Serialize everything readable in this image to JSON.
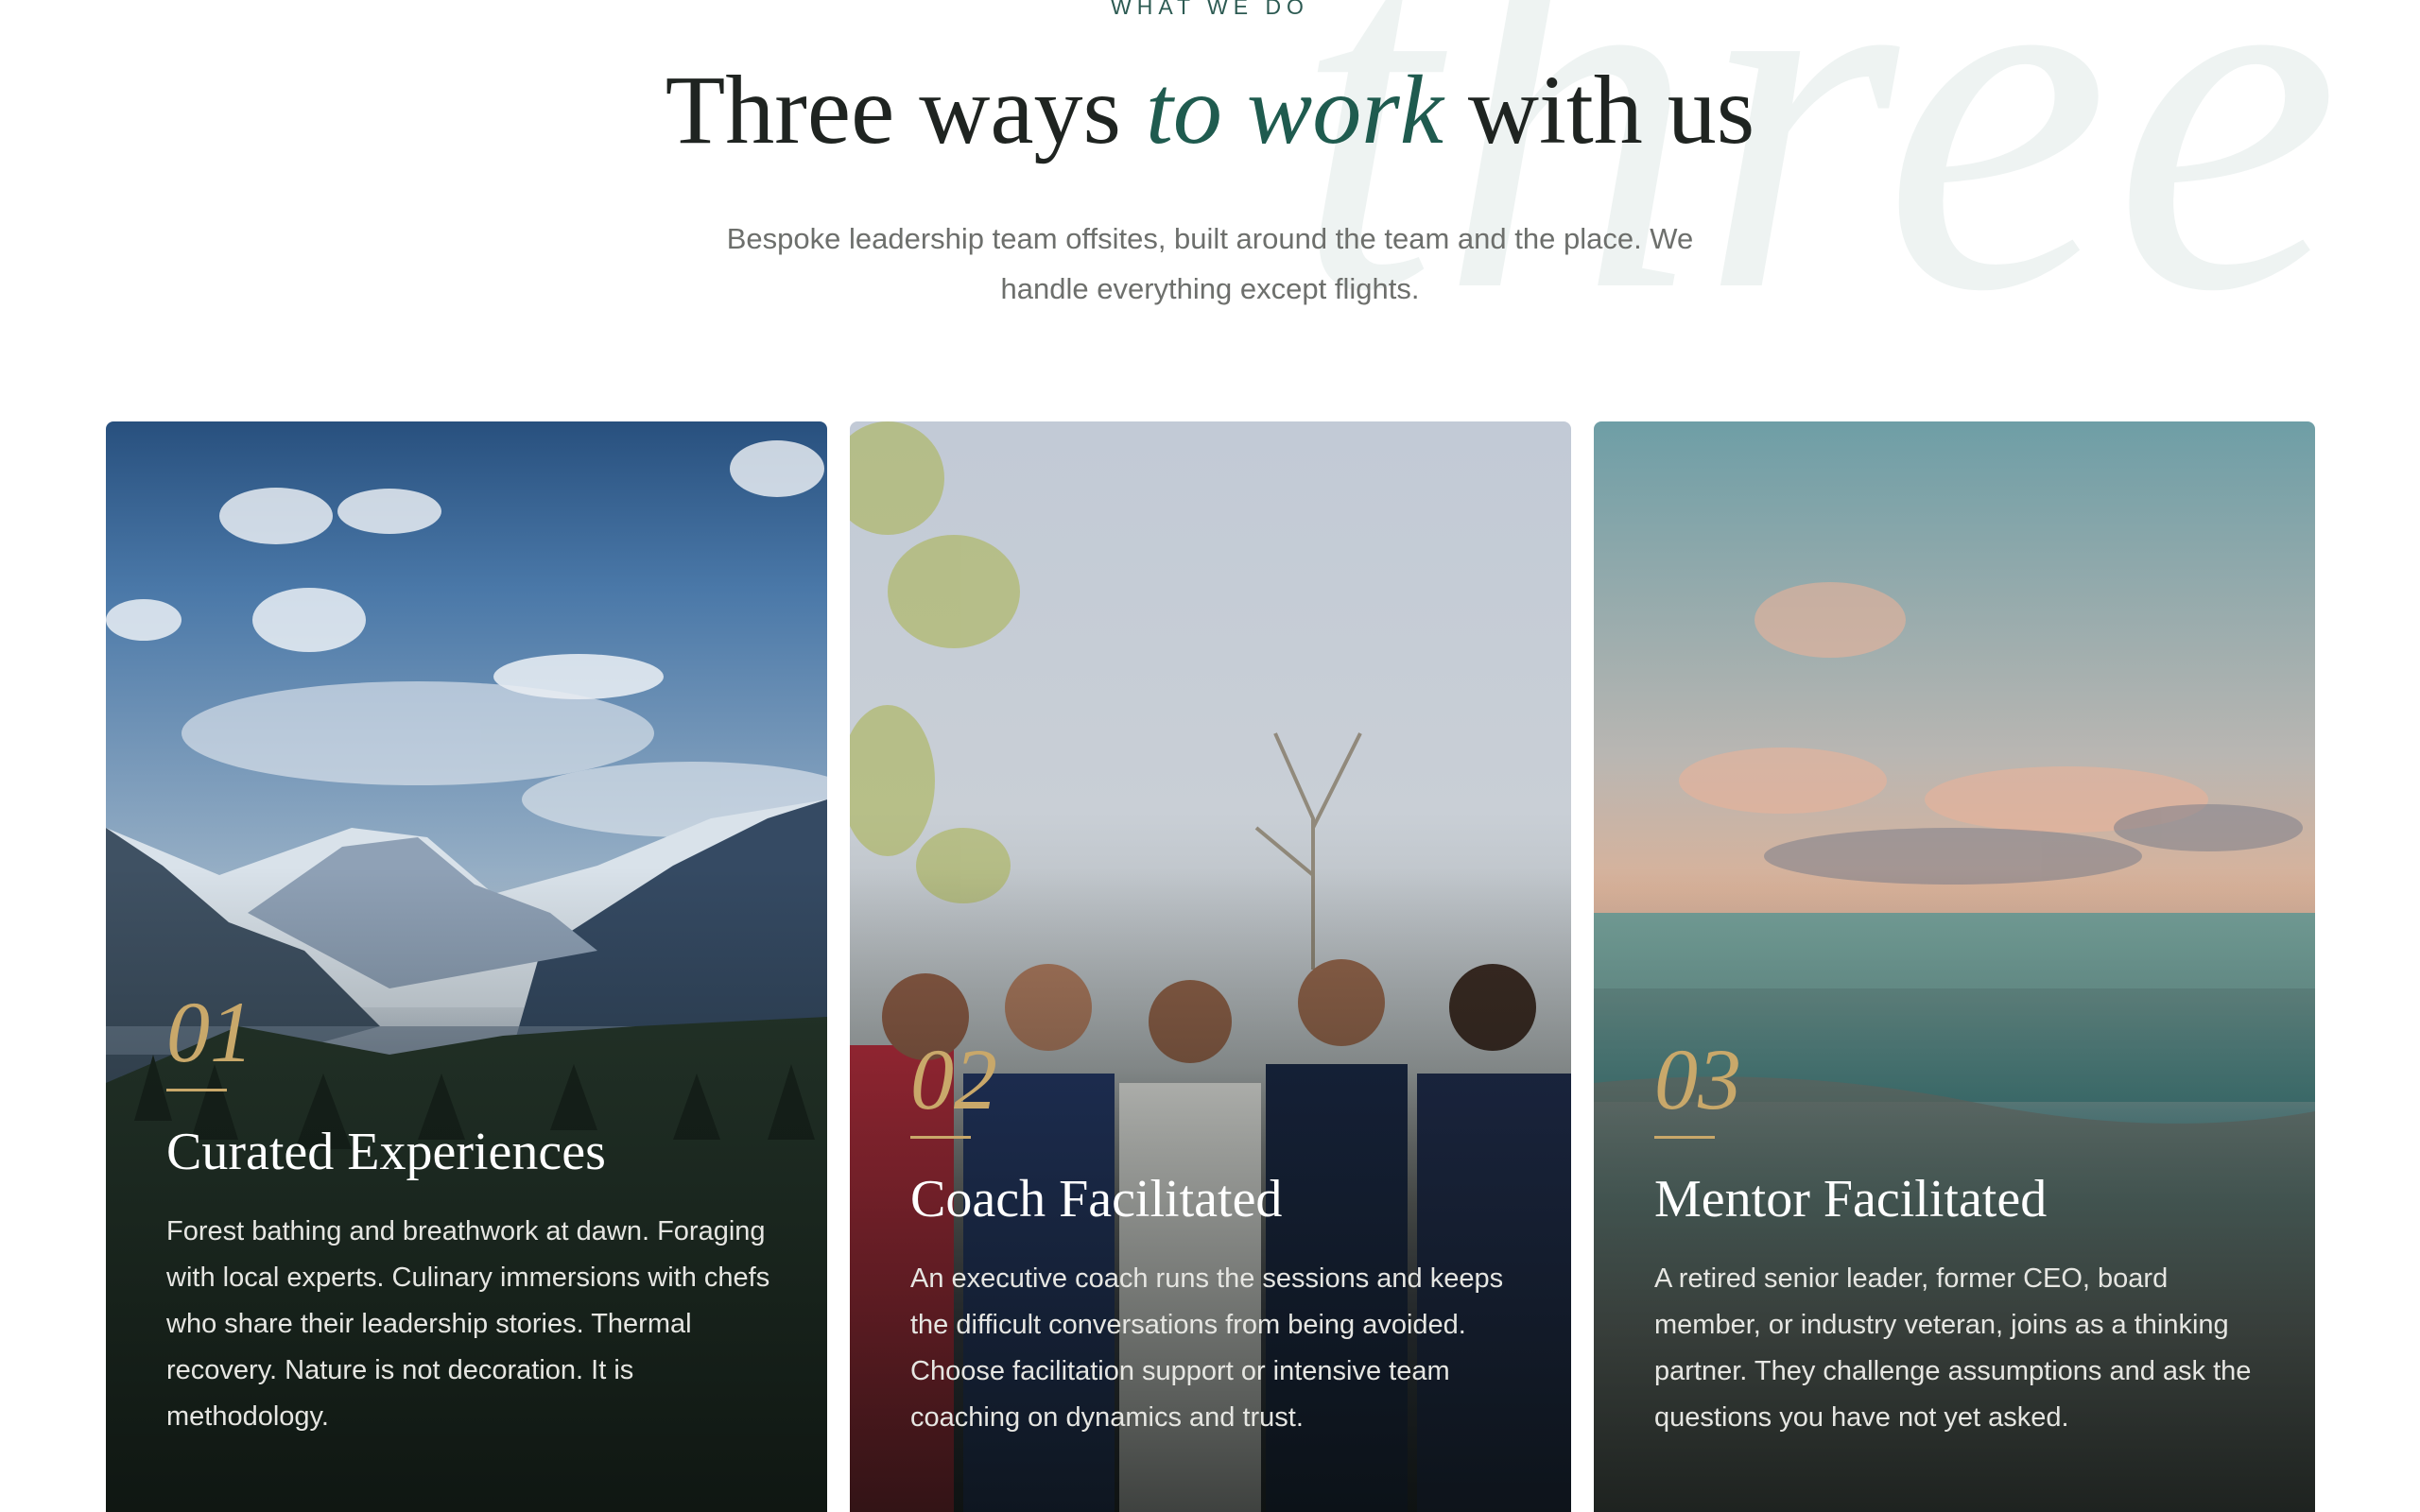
{
  "watermark": "three",
  "header": {
    "eyebrow": "WHAT WE DO",
    "title_part1": "Three ways ",
    "title_accent": "to work",
    "title_part2": " with us",
    "subtitle": "Bespoke leadership team offsites, built around the team and the place. We handle everything except flights."
  },
  "cards": [
    {
      "number": "01",
      "title": "Curated Experiences",
      "text": "Forest bathing and breathwork at dawn. Foraging with local experts. Culinary immersions with chefs who share their leadership stories. Thermal recovery. Nature is not decoration. It is methodology."
    },
    {
      "number": "02",
      "title": "Coach Facilitated",
      "text": "An executive coach runs the sessions and keeps the difficult conversations from being avoided. Choose facilitation support or intensive team coaching on dynamics and trust."
    },
    {
      "number": "03",
      "title": "Mentor Facilitated",
      "text": "A retired senior leader, former CEO, board member, or industry veteran, joins as a thinking partner. They challenge assumptions and ask the questions you have not yet asked."
    }
  ],
  "colors": {
    "accent": "#1f5b4f",
    "gold": "#c9a86a",
    "heading": "#1f2421",
    "body": "#6d6f6c"
  }
}
